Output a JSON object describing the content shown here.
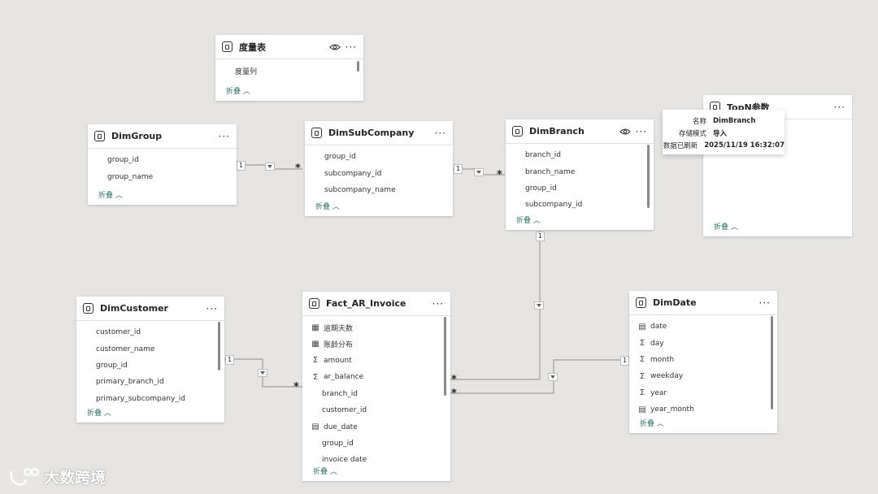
{
  "tables": {
    "measure": {
      "title": "度量表",
      "fields": [
        "度量列"
      ],
      "collapse": "折叠"
    },
    "dimgroup": {
      "title": "DimGroup",
      "fields": [
        "group_id",
        "group_name"
      ],
      "collapse": "折叠"
    },
    "dimsubcompany": {
      "title": "DimSubCompany",
      "fields": [
        "group_id",
        "subcompany_id",
        "subcompany_name"
      ],
      "collapse": "折叠"
    },
    "dimbranch": {
      "title": "DimBranch",
      "fields": [
        "branch_id",
        "branch_name",
        "group_id",
        "subcompany_id"
      ],
      "collapse": "折叠"
    },
    "topn": {
      "title": "TopN参数",
      "collapse": "折叠"
    },
    "dimcustomer": {
      "title": "DimCustomer",
      "fields": [
        "customer_id",
        "customer_name",
        "group_id",
        "primary_branch_id",
        "primary_subcompany_id"
      ],
      "collapse": "折叠"
    },
    "fact": {
      "title": "Fact_AR_Invoice",
      "fields": [
        {
          "name": "逾期天数",
          "icon": "calc-column-icon"
        },
        {
          "name": "账龄分布",
          "icon": "calc-column-icon"
        },
        {
          "name": "amount",
          "icon": "sigma-icon"
        },
        {
          "name": "ar_balance",
          "icon": "sigma-icon"
        },
        {
          "name": "branch_id",
          "icon": ""
        },
        {
          "name": "customer_id",
          "icon": ""
        },
        {
          "name": "due_date",
          "icon": "calendar-icon"
        },
        {
          "name": "group_id",
          "icon": ""
        },
        {
          "name": "invoice date",
          "icon": ""
        }
      ],
      "collapse": "折叠"
    },
    "dimdate": {
      "title": "DimDate",
      "fields": [
        {
          "name": "date",
          "icon": "calendar-icon"
        },
        {
          "name": "day",
          "icon": "sigma-icon"
        },
        {
          "name": "month",
          "icon": "sigma-icon"
        },
        {
          "name": "weekday",
          "icon": "sigma-icon"
        },
        {
          "name": "year",
          "icon": "sigma-icon"
        },
        {
          "name": "year_month",
          "icon": "calendar-icon"
        }
      ],
      "collapse": "折叠"
    }
  },
  "cardinality": {
    "one": "1",
    "many": "*"
  },
  "tooltip": {
    "rows": [
      {
        "key": "名称",
        "value": "DimBranch"
      },
      {
        "key": "存储模式",
        "value": "导入"
      },
      {
        "key": "数据已刷新",
        "value": "2025/11/19 16:32:07"
      }
    ]
  },
  "watermark": {
    "text": "大数跨境"
  },
  "icons": {
    "sigma": "Σ",
    "more": "···"
  }
}
